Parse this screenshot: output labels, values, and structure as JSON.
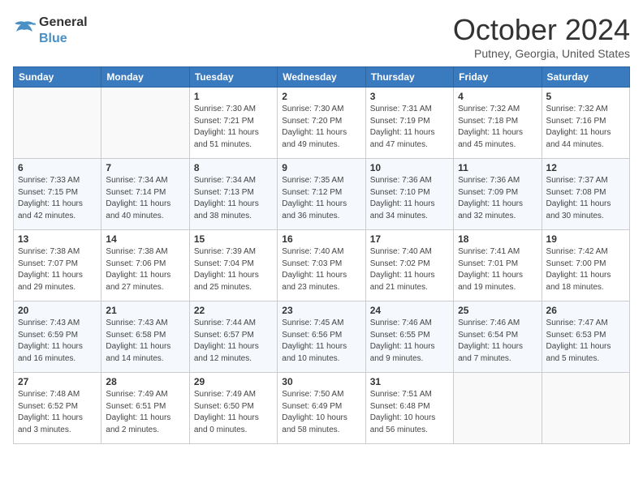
{
  "header": {
    "logo_line1": "General",
    "logo_line2": "Blue",
    "month_title": "October 2024",
    "location": "Putney, Georgia, United States"
  },
  "weekdays": [
    "Sunday",
    "Monday",
    "Tuesday",
    "Wednesday",
    "Thursday",
    "Friday",
    "Saturday"
  ],
  "weeks": [
    [
      {
        "day": "",
        "info": ""
      },
      {
        "day": "",
        "info": ""
      },
      {
        "day": "1",
        "info": "Sunrise: 7:30 AM\nSunset: 7:21 PM\nDaylight: 11 hours\nand 51 minutes."
      },
      {
        "day": "2",
        "info": "Sunrise: 7:30 AM\nSunset: 7:20 PM\nDaylight: 11 hours\nand 49 minutes."
      },
      {
        "day": "3",
        "info": "Sunrise: 7:31 AM\nSunset: 7:19 PM\nDaylight: 11 hours\nand 47 minutes."
      },
      {
        "day": "4",
        "info": "Sunrise: 7:32 AM\nSunset: 7:18 PM\nDaylight: 11 hours\nand 45 minutes."
      },
      {
        "day": "5",
        "info": "Sunrise: 7:32 AM\nSunset: 7:16 PM\nDaylight: 11 hours\nand 44 minutes."
      }
    ],
    [
      {
        "day": "6",
        "info": "Sunrise: 7:33 AM\nSunset: 7:15 PM\nDaylight: 11 hours\nand 42 minutes."
      },
      {
        "day": "7",
        "info": "Sunrise: 7:34 AM\nSunset: 7:14 PM\nDaylight: 11 hours\nand 40 minutes."
      },
      {
        "day": "8",
        "info": "Sunrise: 7:34 AM\nSunset: 7:13 PM\nDaylight: 11 hours\nand 38 minutes."
      },
      {
        "day": "9",
        "info": "Sunrise: 7:35 AM\nSunset: 7:12 PM\nDaylight: 11 hours\nand 36 minutes."
      },
      {
        "day": "10",
        "info": "Sunrise: 7:36 AM\nSunset: 7:10 PM\nDaylight: 11 hours\nand 34 minutes."
      },
      {
        "day": "11",
        "info": "Sunrise: 7:36 AM\nSunset: 7:09 PM\nDaylight: 11 hours\nand 32 minutes."
      },
      {
        "day": "12",
        "info": "Sunrise: 7:37 AM\nSunset: 7:08 PM\nDaylight: 11 hours\nand 30 minutes."
      }
    ],
    [
      {
        "day": "13",
        "info": "Sunrise: 7:38 AM\nSunset: 7:07 PM\nDaylight: 11 hours\nand 29 minutes."
      },
      {
        "day": "14",
        "info": "Sunrise: 7:38 AM\nSunset: 7:06 PM\nDaylight: 11 hours\nand 27 minutes."
      },
      {
        "day": "15",
        "info": "Sunrise: 7:39 AM\nSunset: 7:04 PM\nDaylight: 11 hours\nand 25 minutes."
      },
      {
        "day": "16",
        "info": "Sunrise: 7:40 AM\nSunset: 7:03 PM\nDaylight: 11 hours\nand 23 minutes."
      },
      {
        "day": "17",
        "info": "Sunrise: 7:40 AM\nSunset: 7:02 PM\nDaylight: 11 hours\nand 21 minutes."
      },
      {
        "day": "18",
        "info": "Sunrise: 7:41 AM\nSunset: 7:01 PM\nDaylight: 11 hours\nand 19 minutes."
      },
      {
        "day": "19",
        "info": "Sunrise: 7:42 AM\nSunset: 7:00 PM\nDaylight: 11 hours\nand 18 minutes."
      }
    ],
    [
      {
        "day": "20",
        "info": "Sunrise: 7:43 AM\nSunset: 6:59 PM\nDaylight: 11 hours\nand 16 minutes."
      },
      {
        "day": "21",
        "info": "Sunrise: 7:43 AM\nSunset: 6:58 PM\nDaylight: 11 hours\nand 14 minutes."
      },
      {
        "day": "22",
        "info": "Sunrise: 7:44 AM\nSunset: 6:57 PM\nDaylight: 11 hours\nand 12 minutes."
      },
      {
        "day": "23",
        "info": "Sunrise: 7:45 AM\nSunset: 6:56 PM\nDaylight: 11 hours\nand 10 minutes."
      },
      {
        "day": "24",
        "info": "Sunrise: 7:46 AM\nSunset: 6:55 PM\nDaylight: 11 hours\nand 9 minutes."
      },
      {
        "day": "25",
        "info": "Sunrise: 7:46 AM\nSunset: 6:54 PM\nDaylight: 11 hours\nand 7 minutes."
      },
      {
        "day": "26",
        "info": "Sunrise: 7:47 AM\nSunset: 6:53 PM\nDaylight: 11 hours\nand 5 minutes."
      }
    ],
    [
      {
        "day": "27",
        "info": "Sunrise: 7:48 AM\nSunset: 6:52 PM\nDaylight: 11 hours\nand 3 minutes."
      },
      {
        "day": "28",
        "info": "Sunrise: 7:49 AM\nSunset: 6:51 PM\nDaylight: 11 hours\nand 2 minutes."
      },
      {
        "day": "29",
        "info": "Sunrise: 7:49 AM\nSunset: 6:50 PM\nDaylight: 11 hours\nand 0 minutes."
      },
      {
        "day": "30",
        "info": "Sunrise: 7:50 AM\nSunset: 6:49 PM\nDaylight: 10 hours\nand 58 minutes."
      },
      {
        "day": "31",
        "info": "Sunrise: 7:51 AM\nSunset: 6:48 PM\nDaylight: 10 hours\nand 56 minutes."
      },
      {
        "day": "",
        "info": ""
      },
      {
        "day": "",
        "info": ""
      }
    ]
  ]
}
